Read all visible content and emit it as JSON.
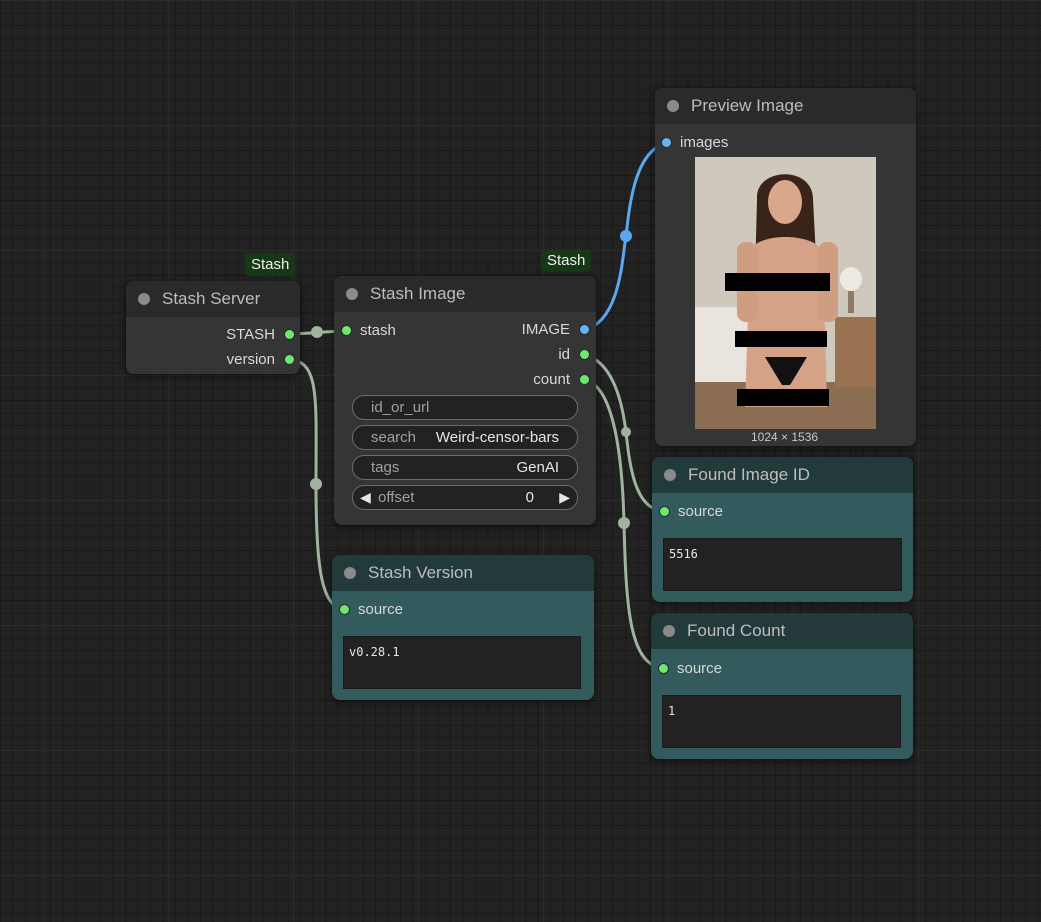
{
  "nodes": {
    "stash_server": {
      "title": "Stash Server",
      "badge": "Stash",
      "outputs": [
        "STASH",
        "version"
      ]
    },
    "stash_image": {
      "title": "Stash Image",
      "badge": "Stash",
      "inputs": [
        "stash"
      ],
      "outputs": [
        "IMAGE",
        "id",
        "count"
      ],
      "widgets": {
        "id_or_url": {
          "label": "id_or_url",
          "value": ""
        },
        "search": {
          "label": "search",
          "value": "Weird-censor-bars"
        },
        "tags": {
          "label": "tags",
          "value": "GenAI"
        },
        "offset": {
          "label": "offset",
          "value": "0"
        }
      }
    },
    "preview_image": {
      "title": "Preview Image",
      "input": "images",
      "dimensions": "1024 × 1536"
    },
    "found_image_id": {
      "title": "Found Image ID",
      "input": "source",
      "text": "5516"
    },
    "found_count": {
      "title": "Found Count",
      "input": "source",
      "text": "1"
    },
    "stash_version": {
      "title": "Stash Version",
      "input": "source",
      "text": "v0.28.1"
    }
  },
  "colors": {
    "canvas_bg": "#222222",
    "node_bg": "#353535",
    "node_title_bg": "#2a2a2a",
    "teal_node_bg": "#335a5c",
    "teal_title_bg": "#233a3b",
    "pin_green": "#6dea6d",
    "pin_blue": "#64b5f6",
    "link_gray": "#9fb39f",
    "link_blue": "#5aa9ee",
    "badge_bg": "#163816"
  },
  "icons": {
    "status_dot": "circle",
    "decrement": "left-triangle-icon",
    "increment": "right-triangle-icon"
  }
}
